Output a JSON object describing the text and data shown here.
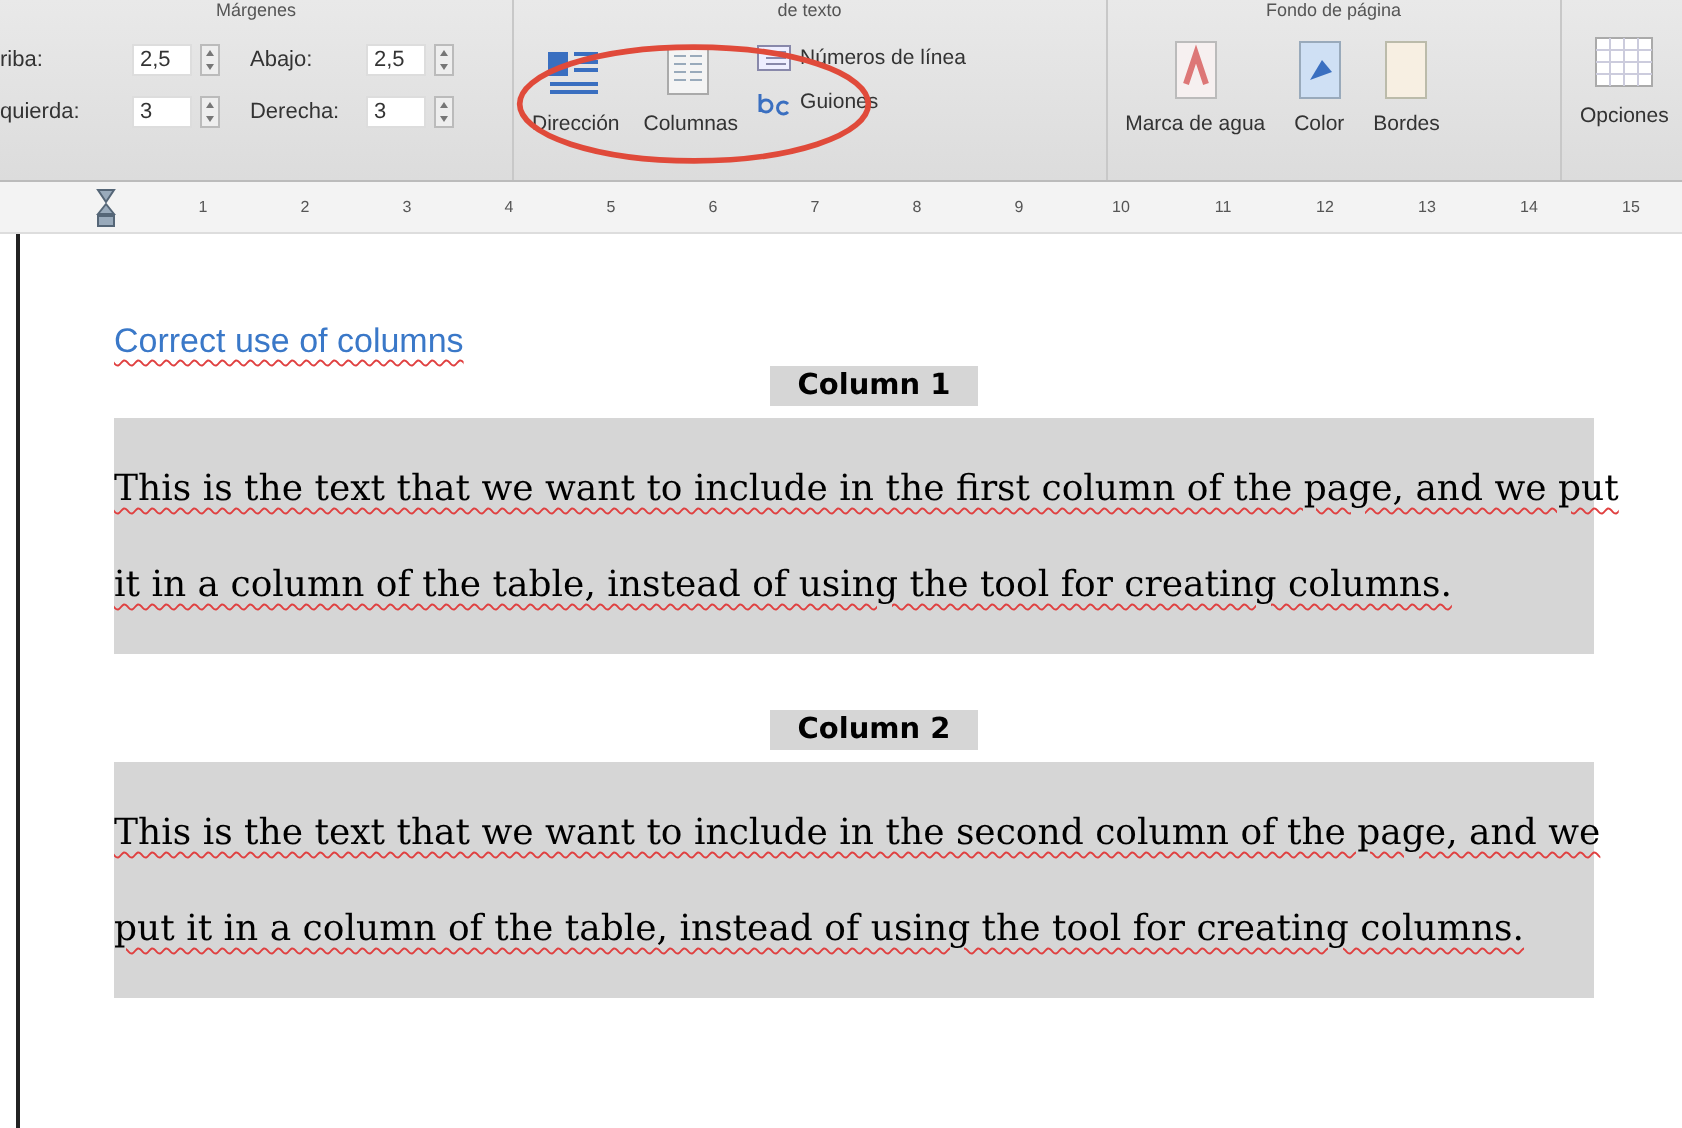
{
  "ribbon": {
    "groups": [
      {
        "kind": "margins",
        "title": "Márgenes",
        "fields": [
          {
            "label": "riba:",
            "value": "2,5"
          },
          {
            "label": "Abajo:",
            "value": "2,5"
          },
          {
            "label": "quierda:",
            "value": "3"
          },
          {
            "label": "Derecha:",
            "value": "3"
          }
        ]
      },
      {
        "kind": "layout",
        "title": "de texto",
        "buttons": [
          {
            "label": "Dirección"
          },
          {
            "label": "Columnas"
          }
        ],
        "small": [
          {
            "label": "Números de línea"
          },
          {
            "label": "Guiones"
          }
        ]
      },
      {
        "kind": "background",
        "title": "Fondo de página",
        "buttons": [
          {
            "label": "Marca de agua"
          },
          {
            "label": "Color"
          },
          {
            "label": "Bordes"
          }
        ]
      },
      {
        "kind": "options",
        "buttons": [
          {
            "label": "Opciones"
          }
        ]
      }
    ]
  },
  "ruler": [
    "1",
    "2",
    "3",
    "4",
    "5",
    "6",
    "7",
    "8",
    "9",
    "10",
    "11",
    "12",
    "13",
    "14",
    "15"
  ],
  "document": {
    "title": "Correct use of columns",
    "sections": [
      {
        "heading": "Column 1",
        "lines": [
          "This is the text that we want to include in the first column of the page, and we put",
          "it in a column of the table, instead of using the tool for creating columns."
        ]
      },
      {
        "heading": "Column 2",
        "lines": [
          "This is the text that we want to include in the second column of the page, and we",
          "put it in a column of the table, instead of using the tool for creating columns."
        ]
      }
    ],
    "spelling_marked": true
  }
}
